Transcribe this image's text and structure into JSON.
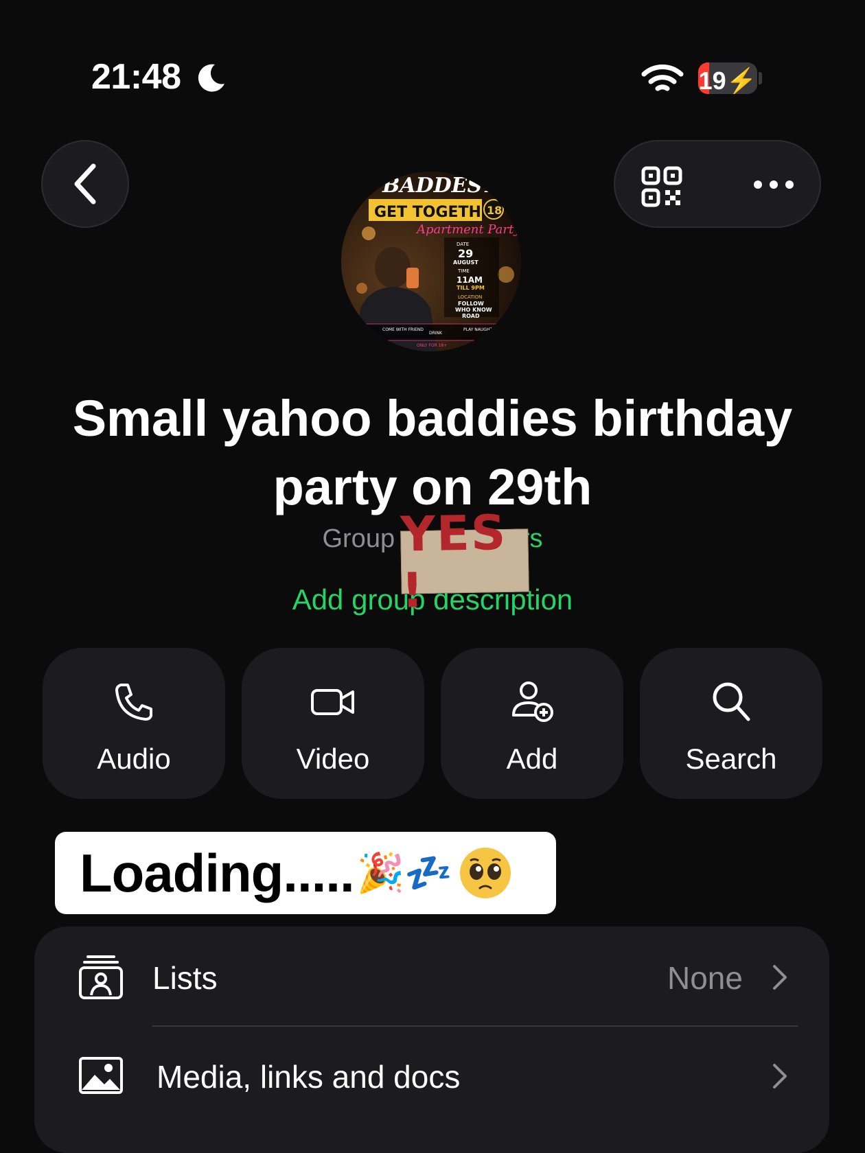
{
  "status_bar": {
    "time": "21:48",
    "battery": "19",
    "battery_level": 0.19
  },
  "group": {
    "title": "Small yahoo baddies birthday party on 29th",
    "subtitle_prefix": "Group · ",
    "subtitle_suffix": "rs",
    "description_link": "Add group description"
  },
  "overlay": {
    "yes_sticker": "YES !"
  },
  "actions": [
    {
      "label": "Audio",
      "icon": "phone-icon"
    },
    {
      "label": "Video",
      "icon": "video-camera-icon"
    },
    {
      "label": "Add",
      "icon": "add-person-icon"
    },
    {
      "label": "Search",
      "icon": "search-icon"
    }
  ],
  "sticker": {
    "text": "Loading.....",
    "emoji": "🎉💤"
  },
  "avatar_poster": {
    "line1": "BADDEST",
    "line2": "GET TOGETHER",
    "line3": "Apartment Party",
    "date_label": "DATE",
    "date_day": "29",
    "date_month": "AUGUST",
    "time_label": "TIME",
    "time_value": "11AM",
    "time_till": "TILL 9PM",
    "location_label": "LOCATION",
    "location_1": "FOLLOW",
    "location_2": "WHO KNOW",
    "location_3": "ROAD",
    "footer_1": "COME WITH FRIEND",
    "footer_2": "DRINK",
    "footer_3": "PLAY NAUGHTY",
    "footer_4": "ONLY FOR 18+",
    "badge": "18"
  },
  "settings_list": [
    {
      "label": "Lists",
      "value": "None",
      "icon": "lists-icon"
    },
    {
      "label": "Media, links and docs",
      "value": "",
      "icon": "image-icon"
    }
  ],
  "colors": {
    "accent_green": "#25d366",
    "background": "#0b0b0b",
    "surface": "#1c1c1e"
  }
}
